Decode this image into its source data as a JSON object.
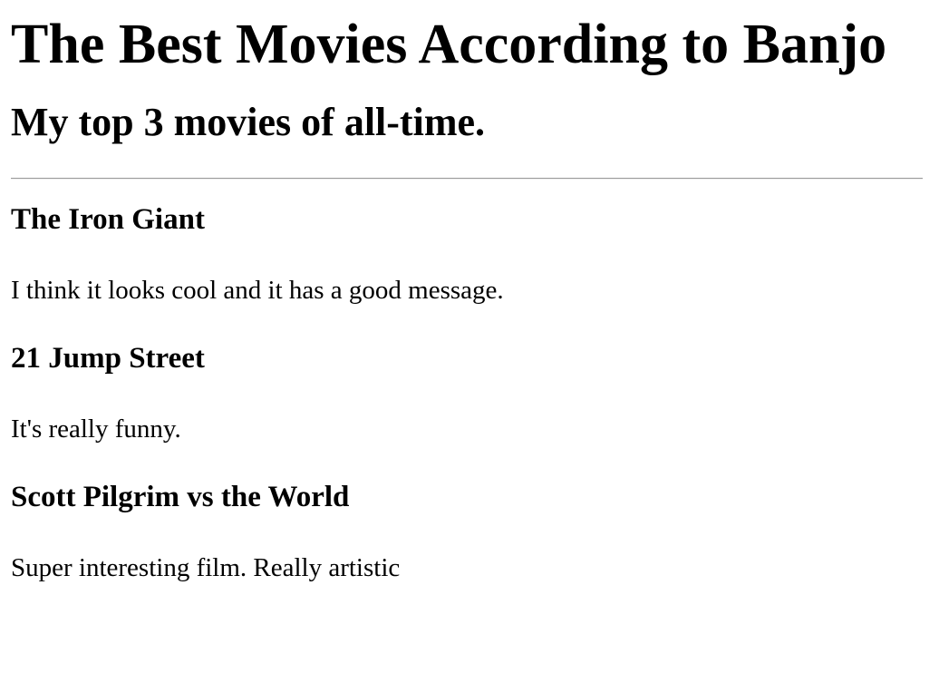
{
  "header": {
    "title": "The Best Movies According to Banjo",
    "subtitle": "My top 3 movies of all-time."
  },
  "movies": [
    {
      "title": "The Iron Giant",
      "description": "I think it looks cool and it has a good message."
    },
    {
      "title": "21 Jump Street",
      "description": "It's really funny."
    },
    {
      "title": "Scott Pilgrim vs the World",
      "description": "Super interesting film. Really artistic"
    }
  ]
}
